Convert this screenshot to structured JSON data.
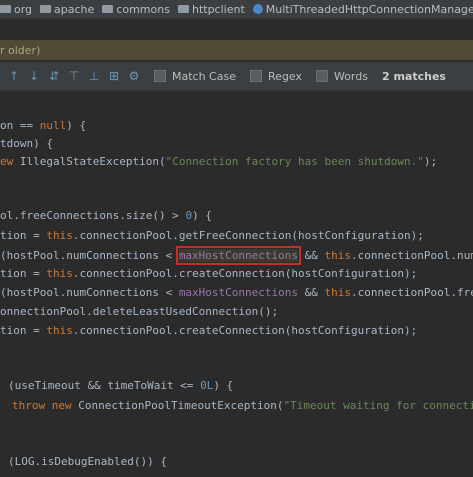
{
  "breadcrumb": {
    "items": [
      {
        "label": "org",
        "icon": "folder-icon"
      },
      {
        "label": "apache",
        "icon": "folder-icon"
      },
      {
        "label": "commons",
        "icon": "folder-icon"
      },
      {
        "label": "httpclient",
        "icon": "folder-icon"
      },
      {
        "label": "MultiThreadedHttpConnectionManager",
        "icon": "class-icon"
      }
    ]
  },
  "notice": {
    "text": "r older)"
  },
  "search": {
    "match_case_label": "Match Case",
    "regex_label": "Regex",
    "words_label": "Words",
    "matches_text": "2 matches"
  },
  "code": {
    "l1a": "on == ",
    "l1b": "null",
    "l1c": ") {",
    "l2": "tdown) {",
    "l3a": "ew ",
    "l3b": "IllegalStateException(",
    "l3c": "\"Connection factory has been shutdown.\"",
    "l3d": ");",
    "l4a": "ol.freeConnections.size() > ",
    "l4b": "0",
    "l4c": ") {",
    "l5a": "tion = ",
    "l5b": "this",
    "l5c": ".connectionPool.getFreeConnection(hostConfiguration);",
    "l6a": "(hostPool.numConnections < ",
    "l6b": "maxHostConnections",
    "l6c": " && ",
    "l6d": "this",
    "l6e": ".connectionPool.numC",
    "l7a": "tion = ",
    "l7b": "this",
    "l7c": ".connectionPool.createConnection(hostConfiguration);",
    "l8a": "(hostPool.numConnections < ",
    "l8b": "maxHostConnections",
    "l8c": " && ",
    "l8d": "this",
    "l8e": ".connectionPool.free",
    "l9": "onnectionPool.deleteLeastUsedConnection();",
    "l10a": "tion = ",
    "l10b": "this",
    "l10c": ".connectionPool.createConnection(hostConfiguration);",
    "l11a": "(useTimeout && timeToWait <= ",
    "l11b": "0L",
    "l11c": ") {",
    "l12a": "throw new ",
    "l12b": "ConnectionPoolTimeoutException(",
    "l12c": "\"Timeout waiting for connectio",
    "l13": "(LOG.isDebugEnabled()) {"
  },
  "colors": {
    "keyword": "#cc7832",
    "string": "#6a8759",
    "field": "#9876aa",
    "highlight_border": "#c0302c"
  }
}
